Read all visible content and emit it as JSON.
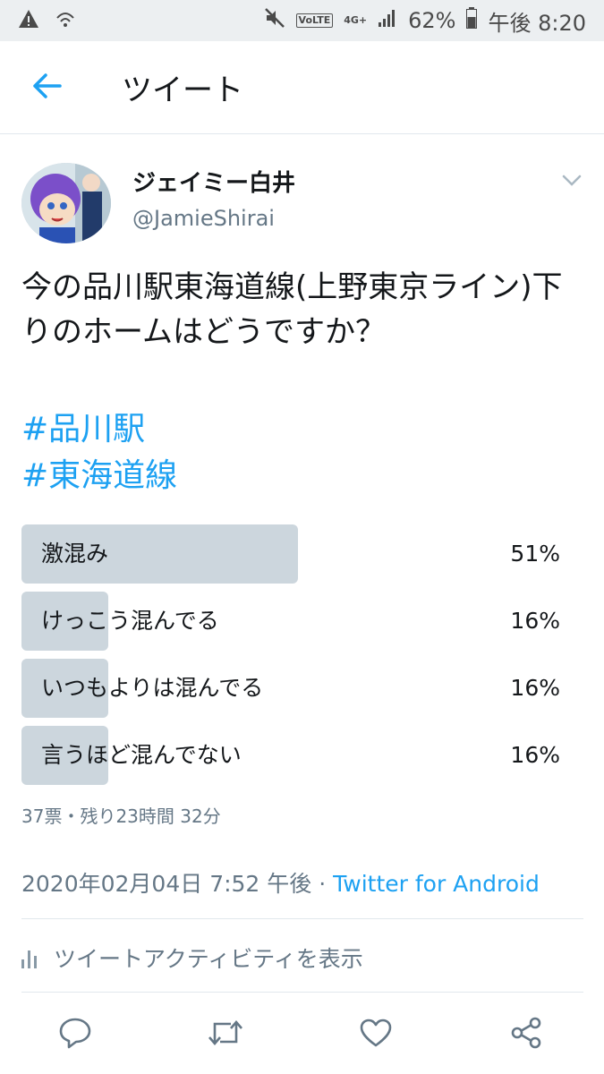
{
  "status_bar": {
    "volte": "VoLTE",
    "network": "4G+",
    "battery": "62%",
    "time": "午後 8:20"
  },
  "header": {
    "title": "ツイート",
    "back_icon": "arrow-left-icon"
  },
  "author": {
    "display_name": "ジェイミー白井",
    "handle": "@JamieShirai"
  },
  "tweet": {
    "text": "今の品川駅東海道線(上野東京ライン)下りのホームはどうですか？",
    "hashtags": [
      "#品川駅",
      "#東海道線"
    ]
  },
  "poll": {
    "options": [
      {
        "label": "激混み",
        "percent": "51%",
        "fraction": 0.51
      },
      {
        "label": "けっこう混んでる",
        "percent": "16%",
        "fraction": 0.16
      },
      {
        "label": "いつもよりは混んでる",
        "percent": "16%",
        "fraction": 0.16
      },
      {
        "label": "言うほど混んでない",
        "percent": "16%",
        "fraction": 0.16
      }
    ],
    "meta": "37票・残り23時間 32分"
  },
  "timestamp": {
    "datetime": "2020年02月04日 7:52 午後",
    "separator": " · ",
    "source": "Twitter for Android"
  },
  "activity": {
    "label": "ツイートアクティビティを表示"
  },
  "colors": {
    "accent": "#1da1f2",
    "poll_fill": "#ccd6dd",
    "secondary_text": "#657786"
  }
}
